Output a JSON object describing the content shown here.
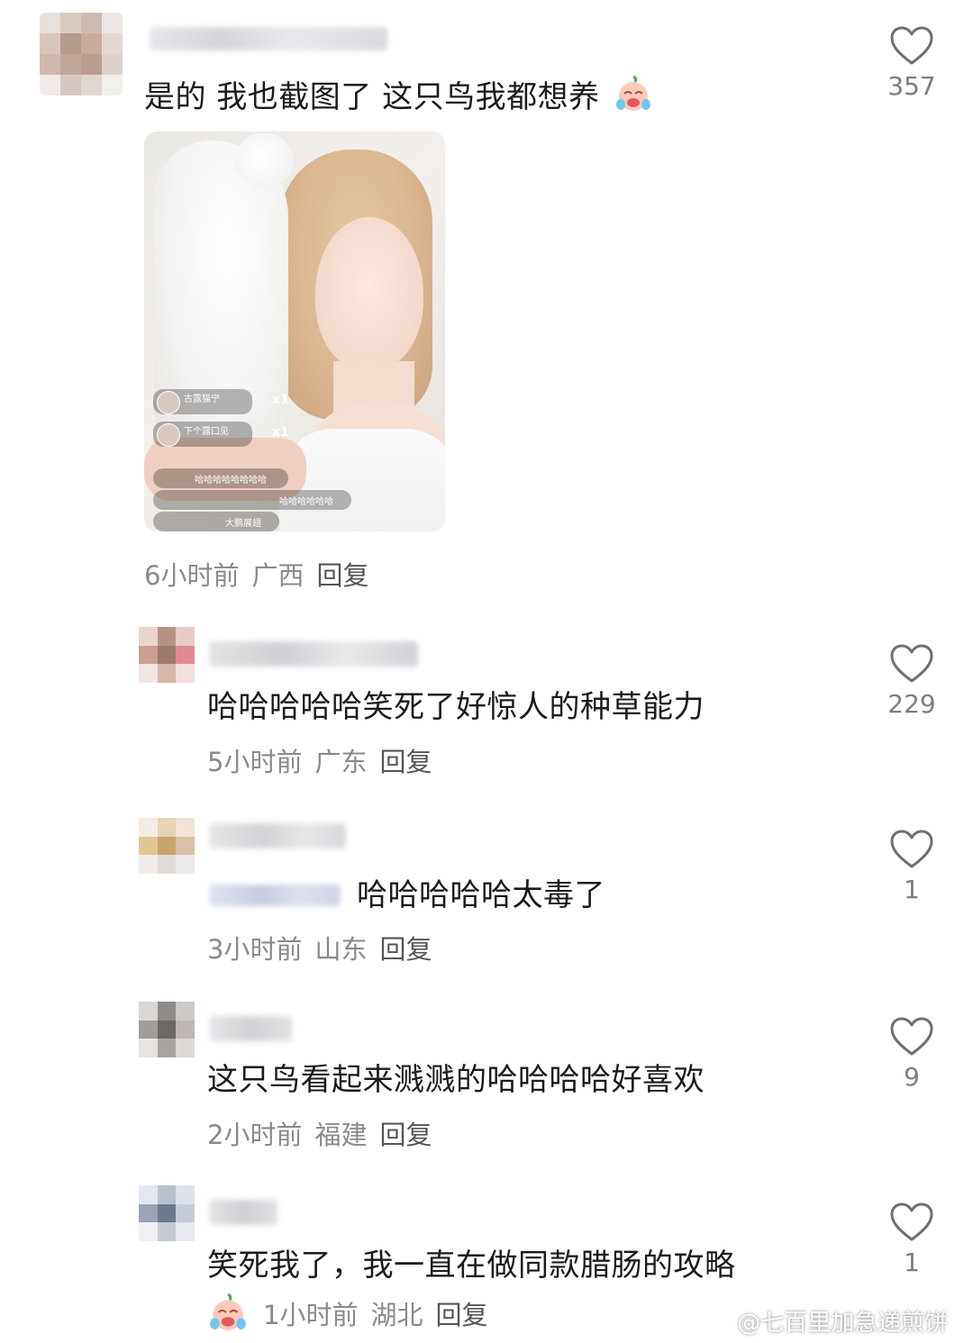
{
  "comments": [
    {
      "text": "是的 我也截图了 这只鸟我都想养",
      "time": "6小时前",
      "location": "广西",
      "reply": "回复",
      "likes": "357",
      "image_overlay": {
        "gift1_user": "古露猫宁",
        "gift2_user": "下个露口见",
        "gift_count1": "x1",
        "gift_count2": "x1",
        "chat1": "哈哈哈哈哈哈哈哈",
        "chat2": "哈哈哈哈哈哈",
        "chat3": "大鹏展翅"
      }
    },
    {
      "text": "哈哈哈哈哈笑死了好惊人的种草能力",
      "time": "5小时前",
      "location": "广东",
      "reply": "回复",
      "likes": "229"
    },
    {
      "text": "哈哈哈哈哈太毒了",
      "time": "3小时前",
      "location": "山东",
      "reply": "回复",
      "likes": "1"
    },
    {
      "text": "这只鸟看起来溅溅的哈哈哈哈好喜欢",
      "time": "2小时前",
      "location": "福建",
      "reply": "回复",
      "likes": "9"
    },
    {
      "text": "笑死我了，我一直在做同款腊肠的攻略",
      "time": "1小时前",
      "location": "湖北",
      "reply": "回复",
      "likes": "1"
    }
  ],
  "watermark": "@七百里加急递煎饼",
  "icons": {
    "like": "heart-outline-icon",
    "emoji": "crying-laugh-emoji-icon"
  },
  "colors": {
    "text": "#1b1b1b",
    "meta": "#8a8a8a",
    "heart_stroke": "#6f6f6f"
  }
}
